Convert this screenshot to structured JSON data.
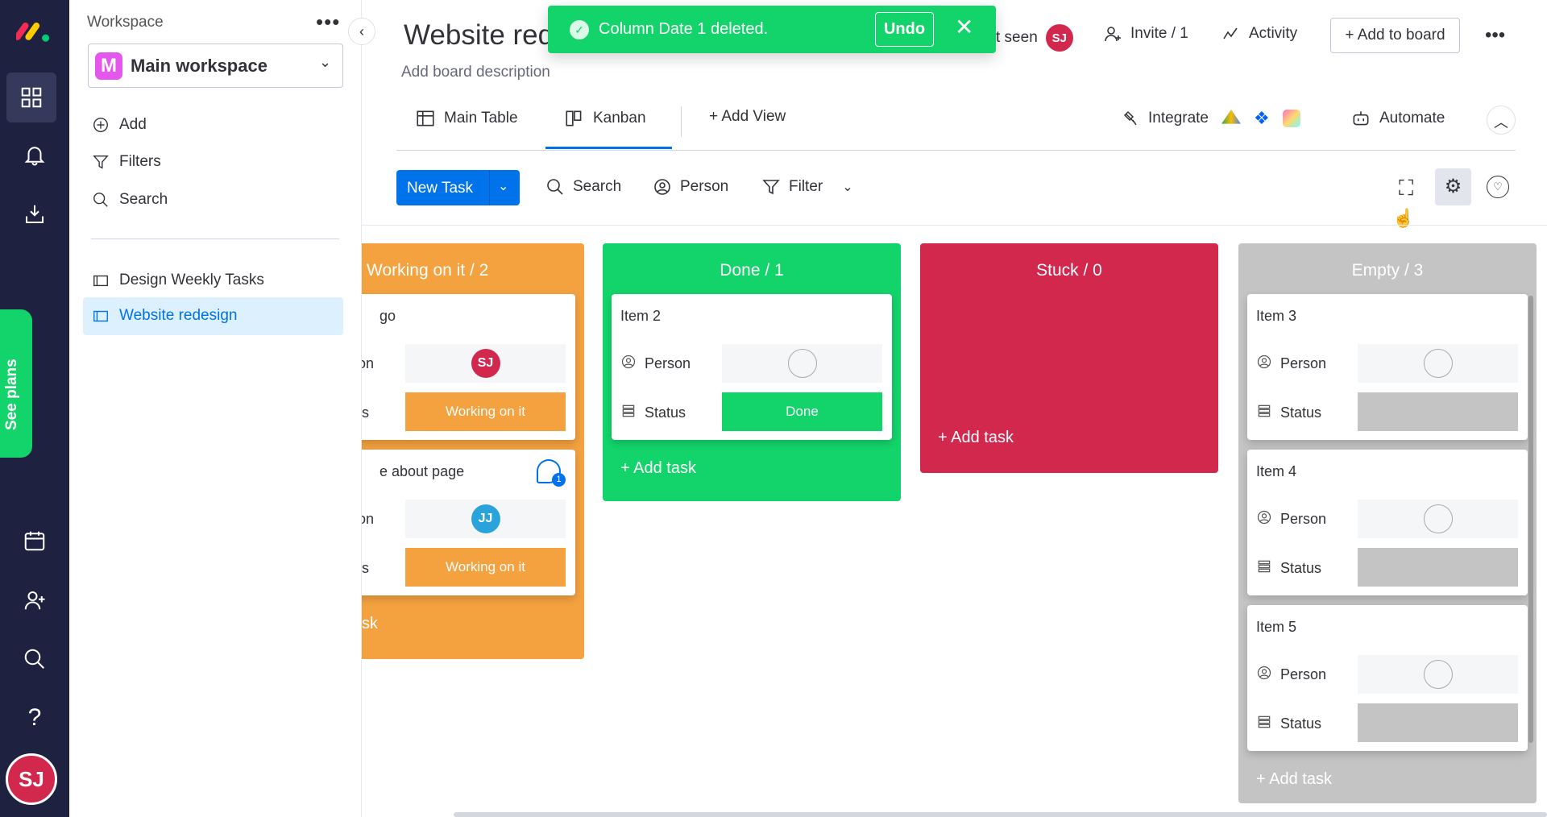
{
  "rail": {
    "icons": [
      "monday-logo",
      "apps-grid-icon",
      "bell-icon",
      "inbox-download-icon",
      "calendar-icon",
      "invite-user-icon",
      "search-icon",
      "help-icon"
    ],
    "see_plans": "See plans",
    "avatar": "SJ",
    "avatar_color": "#d2284e"
  },
  "workspace": {
    "label": "Workspace",
    "name": "Main workspace",
    "badge": "M",
    "actions": [
      {
        "label": "Add",
        "icon": "plus-circle-icon"
      },
      {
        "label": "Filters",
        "icon": "filter-icon"
      },
      {
        "label": "Search",
        "icon": "search-icon"
      }
    ],
    "boards": [
      {
        "label": "Design Weekly Tasks",
        "active": false
      },
      {
        "label": "Website redesign",
        "active": true
      }
    ]
  },
  "header": {
    "title": "Website red",
    "description": "Add board description",
    "last_seen": "t seen",
    "last_seen_avatar": "SJ",
    "invite": "Invite / 1",
    "activity": "Activity",
    "add_to_board": "+ Add to board"
  },
  "toast": {
    "message": "Column Date 1 deleted.",
    "undo": "Undo"
  },
  "tabs": [
    {
      "label": "Main Table",
      "active": false
    },
    {
      "label": "Kanban",
      "active": true
    },
    {
      "label": "+ Add View",
      "active": false
    }
  ],
  "integrations": {
    "integrate": "Integrate",
    "automate": "Automate"
  },
  "toolbar": {
    "new_task": "New Task",
    "search": "Search",
    "person": "Person",
    "filter": "Filter"
  },
  "colors": {
    "working": "#f4a23f",
    "done": "#13d46a",
    "stuck": "#d2284e",
    "empty": "#c4c4c4",
    "primary": "#0073ea"
  },
  "columns": [
    {
      "key": "working",
      "title": "Working on it / 2",
      "add_task": "sk",
      "cards": [
        {
          "title": "go",
          "person": "SJ",
          "person_color": "#d2284e",
          "status": "Working on it",
          "comments": null
        },
        {
          "title": "e about page",
          "person": "JJ",
          "person_color": "#2aa3dc",
          "status": "Working on it",
          "comments": "1"
        }
      ]
    },
    {
      "key": "done",
      "title": "Done / 1",
      "add_task": "+ Add task",
      "cards": [
        {
          "title": "Item 2",
          "person": null,
          "status": "Done"
        }
      ]
    },
    {
      "key": "stuck",
      "title": "Stuck / 0",
      "add_task": "+ Add task",
      "cards": []
    },
    {
      "key": "empty",
      "title": "Empty / 3",
      "add_task": "+ Add task",
      "cards": [
        {
          "title": "Item 3",
          "person": null,
          "status": ""
        },
        {
          "title": "Item 4",
          "person": null,
          "status": ""
        },
        {
          "title": "Item 5",
          "person": null,
          "status": ""
        }
      ]
    }
  ],
  "card_labels": {
    "person": "Person",
    "status": "Status"
  }
}
